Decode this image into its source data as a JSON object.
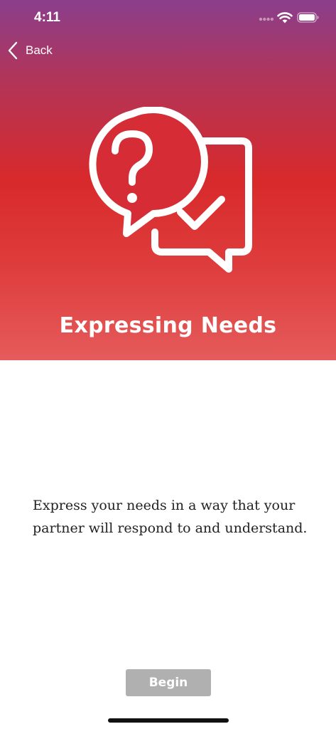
{
  "status_bar": {
    "time": "4:11"
  },
  "nav": {
    "back_label": "Back"
  },
  "hero": {
    "icon": "question-and-check-speech-bubbles",
    "title": "Expressing Needs"
  },
  "content": {
    "description": "Express your needs in a way that your partner will respond to and understand."
  },
  "actions": {
    "begin_label": "Begin"
  },
  "colors": {
    "gradient_top": "#8a3e8c",
    "gradient_mid": "#d8292b",
    "gradient_bottom": "#e55b5b",
    "button_disabled": "#b0b0b0"
  }
}
